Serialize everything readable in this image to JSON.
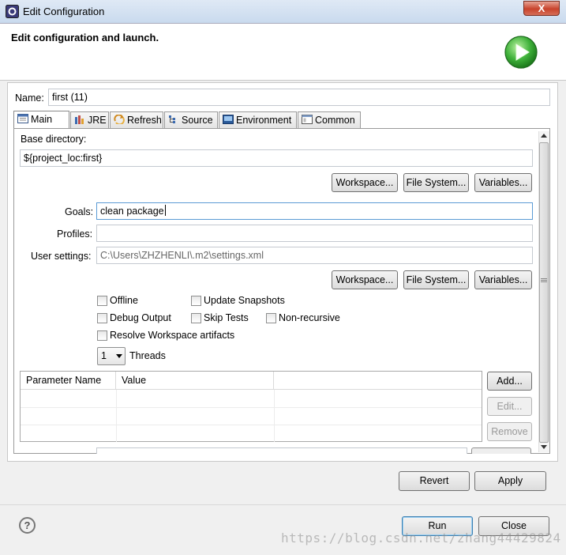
{
  "window": {
    "title": "Edit Configuration",
    "close_glyph": "X"
  },
  "header": {
    "title": "Edit configuration and launch."
  },
  "name": {
    "label": "Name:",
    "value": "first (11)"
  },
  "tabs": [
    {
      "label": "Main",
      "icon": "main-tab-icon"
    },
    {
      "label": "JRE",
      "icon": "jre-icon"
    },
    {
      "label": "Refresh",
      "icon": "refresh-icon"
    },
    {
      "label": "Source",
      "icon": "source-icon"
    },
    {
      "label": "Environment",
      "icon": "environment-icon"
    },
    {
      "label": "Common",
      "icon": "common-icon"
    }
  ],
  "main": {
    "base_dir_label": "Base directory:",
    "base_dir_value": "${project_loc:first}",
    "workspace_btn": "Workspace...",
    "filesystem_btn": "File System...",
    "variables_btn": "Variables...",
    "goals_label": "Goals:",
    "goals_value": "clean package",
    "profiles_label": "Profiles:",
    "profiles_value": "",
    "user_settings_label": "User settings:",
    "user_settings_value": "C:\\Users\\ZHZHENLI\\.m2\\settings.xml",
    "offline": "Offline",
    "update_snapshots": "Update Snapshots",
    "debug_output": "Debug Output",
    "skip_tests": "Skip Tests",
    "non_recursive": "Non-recursive",
    "resolve_workspace": "Resolve Workspace artifacts",
    "threads_value": "1",
    "threads_label": "Threads",
    "table_headers": [
      "Parameter Name",
      "Value"
    ],
    "add_btn": "Add...",
    "edit_btn": "Edit...",
    "remove_btn": "Remove"
  },
  "footer": {
    "revert": "Revert",
    "apply": "Apply",
    "run": "Run",
    "close": "Close",
    "help_glyph": "?"
  },
  "watermark": "https://blog.csdn.net/zhang44429824",
  "colors": {
    "accent": "#3c7fb1",
    "run_green": "#2f9e2a"
  }
}
